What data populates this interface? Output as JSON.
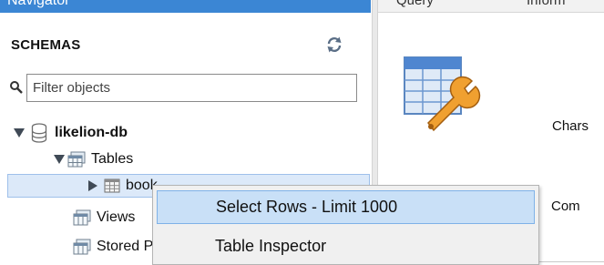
{
  "navigator": {
    "title": "Navigator"
  },
  "top_tabs": {
    "query_label": "Query",
    "info_label": "Inform"
  },
  "schemas": {
    "title": "SCHEMAS",
    "filter_placeholder": "Filter objects"
  },
  "tree": {
    "database": "likelion-db",
    "tables": "Tables",
    "selected_table": "book",
    "views": "Views",
    "stored": "Stored Procedures"
  },
  "context_menu": {
    "items": [
      {
        "label": "Select Rows - Limit 1000"
      },
      {
        "label": "Table Inspector"
      }
    ]
  },
  "info_panel": {
    "charset_label": "Chars",
    "comment_label": "Com"
  },
  "colors": {
    "accent": "#3b86d4",
    "selection": "#dce9f9",
    "menu_hover": "#c9e0f7"
  }
}
